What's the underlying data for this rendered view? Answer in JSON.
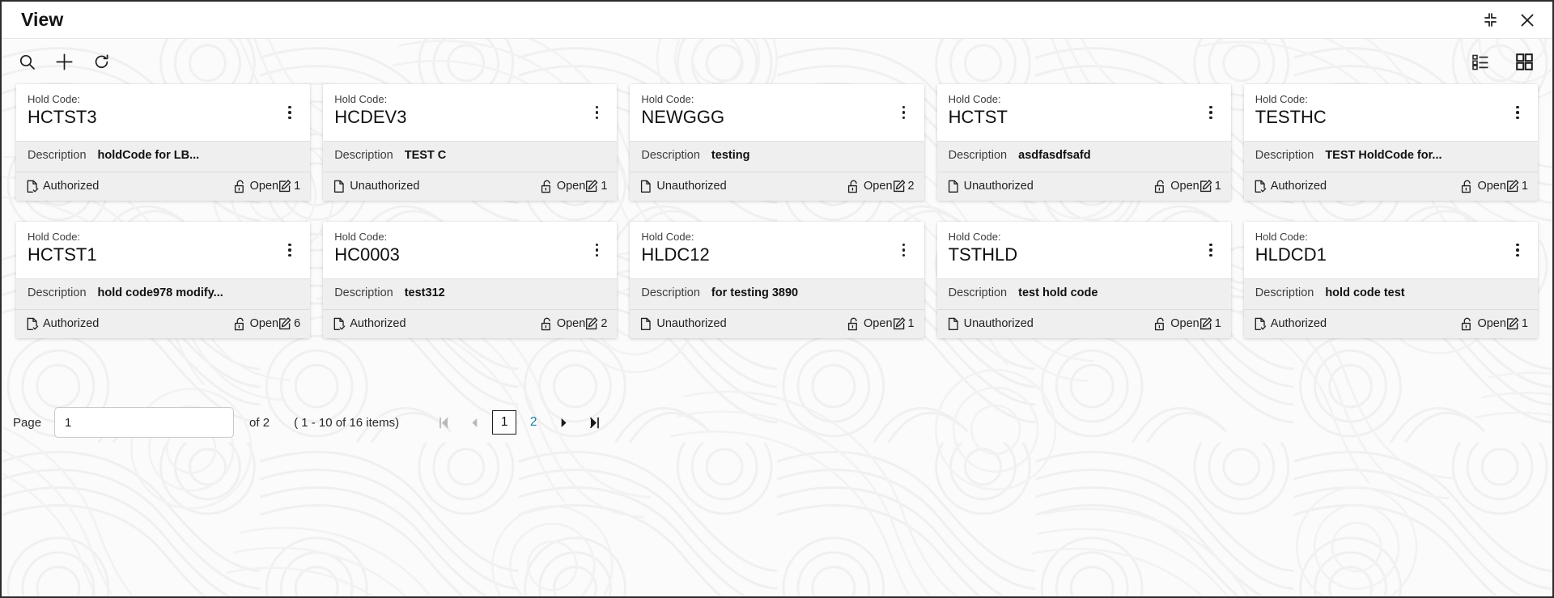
{
  "window": {
    "title": "View",
    "collapse_icon": "collapse-inward-icon",
    "close_icon": "close-icon"
  },
  "toolbar": {
    "search_icon": "search-icon",
    "add_icon": "plus-icon",
    "refresh_icon": "refresh-icon",
    "list_view_icon": "list-view-icon",
    "grid_view_icon": "grid-view-icon",
    "active_view": "grid"
  },
  "card_labels": {
    "hold_code": "Hold Code:",
    "description": "Description",
    "menu_icon": "kebab-menu-icon",
    "authorized_icon": "document-check-icon",
    "unauthorized_icon": "document-icon",
    "lock_icon": "unlock-icon",
    "count_icon": "edit-note-icon"
  },
  "cards": [
    {
      "code": "HCTST3",
      "description": "holdCode for LB...",
      "auth": "Authorized",
      "lock": "Open",
      "count": "1"
    },
    {
      "code": "HCDEV3",
      "description": "TEST C",
      "auth": "Unauthorized",
      "lock": "Open",
      "count": "1"
    },
    {
      "code": "NEWGGG",
      "description": "testing",
      "auth": "Unauthorized",
      "lock": "Open",
      "count": "2"
    },
    {
      "code": "HCTST",
      "description": "asdfasdfsafd",
      "auth": "Unauthorized",
      "lock": "Open",
      "count": "1"
    },
    {
      "code": "TESTHC",
      "description": "TEST HoldCode for...",
      "auth": "Authorized",
      "lock": "Open",
      "count": "1"
    },
    {
      "code": "HCTST1",
      "description": "hold code978 modify...",
      "auth": "Authorized",
      "lock": "Open",
      "count": "6"
    },
    {
      "code": "HC0003",
      "description": "test312",
      "auth": "Authorized",
      "lock": "Open",
      "count": "2"
    },
    {
      "code": "HLDC12",
      "description": "for testing 3890",
      "auth": "Unauthorized",
      "lock": "Open",
      "count": "1"
    },
    {
      "code": "TSTHLD",
      "description": "test hold code",
      "auth": "Unauthorized",
      "lock": "Open",
      "count": "1"
    },
    {
      "code": "HLDCD1",
      "description": "hold code test",
      "auth": "Authorized",
      "lock": "Open",
      "count": "1"
    }
  ],
  "pagination": {
    "page_label": "Page",
    "page_value": "1",
    "of_text": "of 2",
    "range_text": "( 1 - 10 of 16 items)",
    "first_icon": "first-page-icon",
    "prev_icon": "prev-page-icon",
    "next_icon": "next-page-icon",
    "last_icon": "last-page-icon",
    "pages": [
      "1",
      "2"
    ],
    "active_page": "1",
    "prev_disabled": true,
    "next_disabled": false,
    "link_color": "#1a7fa8"
  }
}
